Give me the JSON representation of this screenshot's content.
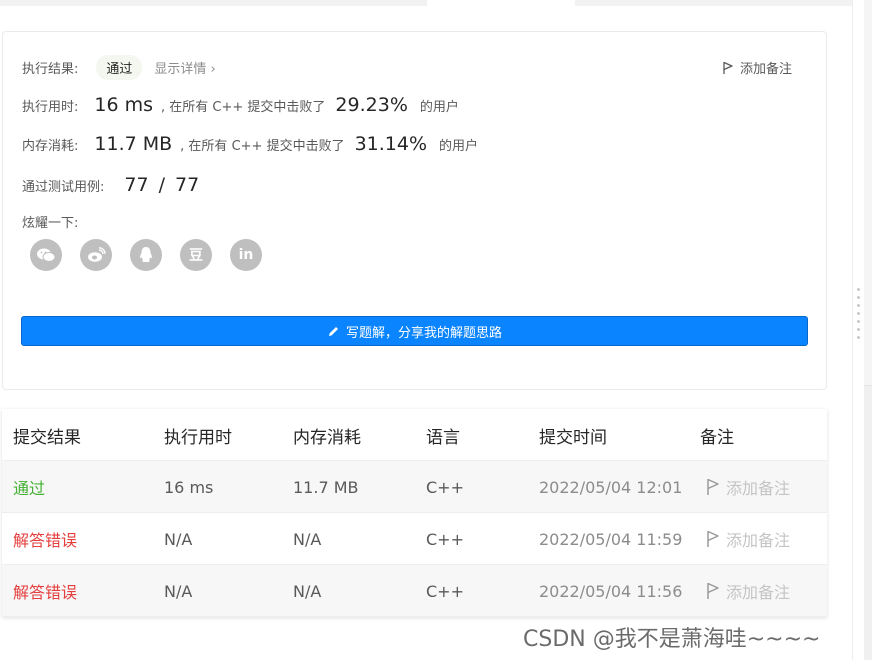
{
  "result": {
    "label": "执行结果:",
    "status": "通过",
    "detail_link": "显示详情 ›",
    "add_note": "添加备注"
  },
  "runtime": {
    "label": "执行用时:",
    "value": "16 ms",
    "beat_prefix": ", 在所有 C++ 提交中击败了",
    "percent": "29.23%",
    "suffix": "的用户"
  },
  "memory": {
    "label": "内存消耗:",
    "value": "11.7 MB",
    "beat_prefix": ", 在所有 C++ 提交中击败了",
    "percent": "31.14%",
    "suffix": "的用户"
  },
  "tests": {
    "label": "通过测试用例:",
    "passed": "77",
    "separator": "/",
    "total": "77"
  },
  "share": {
    "label": "炫耀一下:",
    "icons": [
      "wechat-icon",
      "weibo-icon",
      "qq-icon",
      "douban-icon",
      "linkedin-icon"
    ],
    "douban_glyph": "豆",
    "linkedin_glyph": "in"
  },
  "write_solution_button": "写题解，分享我的解题思路",
  "table": {
    "headers": [
      "提交结果",
      "执行用时",
      "内存消耗",
      "语言",
      "提交时间",
      "备注"
    ],
    "rows": [
      {
        "status": "通过",
        "status_color": "#45b035",
        "runtime": "16 ms",
        "memory": "11.7 MB",
        "lang": "C++",
        "time": "2022/05/04 12:01",
        "note": "添加备注"
      },
      {
        "status": "解答错误",
        "status_color": "#e53e3e",
        "runtime": "N/A",
        "memory": "N/A",
        "lang": "C++",
        "time": "2022/05/04 11:59",
        "note": "添加备注"
      },
      {
        "status": "解答错误",
        "status_color": "#e53e3e",
        "runtime": "N/A",
        "memory": "N/A",
        "lang": "C++",
        "time": "2022/05/04 11:56",
        "note": "添加备注"
      }
    ]
  },
  "watermark": "CSDN @我不是萧海哇~~~~",
  "colors": {
    "accent_button": "#0a84ff",
    "accepted": "#45b035",
    "wrong_answer": "#e53e3e"
  }
}
